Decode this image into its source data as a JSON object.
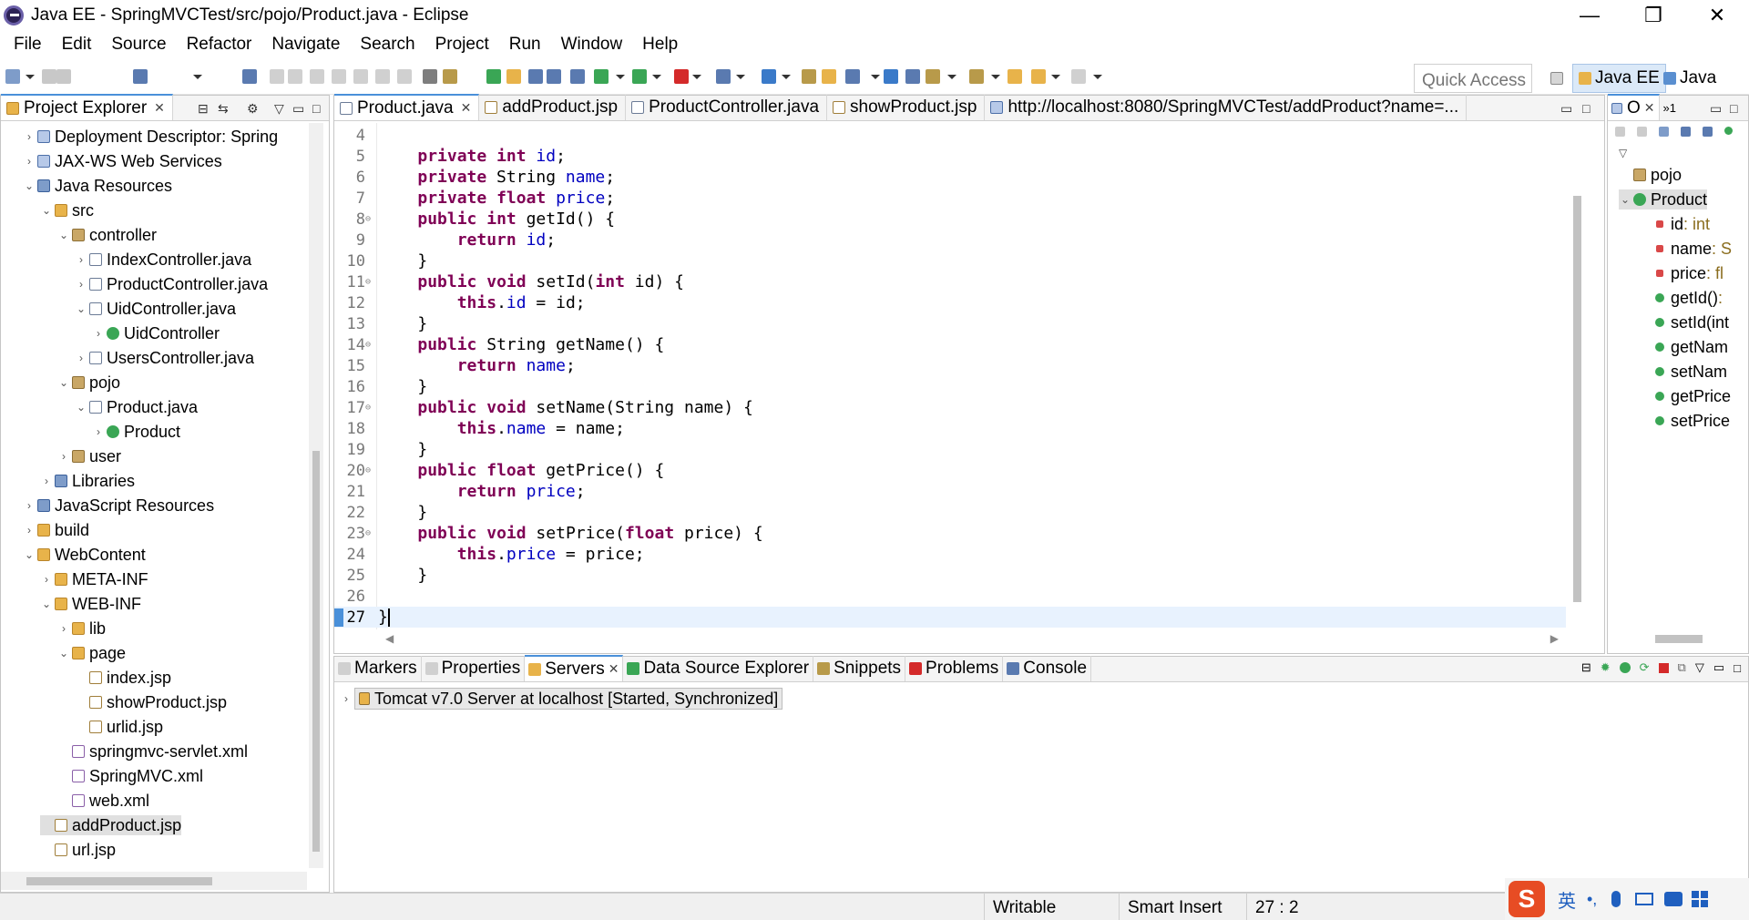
{
  "window": {
    "title": "Java EE - SpringMVCTest/src/pojo/Product.java - Eclipse",
    "minimize": "—",
    "restore": "❐",
    "close": "✕"
  },
  "menu": [
    "File",
    "Edit",
    "Source",
    "Refactor",
    "Navigate",
    "Search",
    "Project",
    "Run",
    "Window",
    "Help"
  ],
  "toolbar": {
    "quick_access": "Quick Access",
    "perspectives": [
      "Java EE",
      "Java"
    ]
  },
  "project_explorer": {
    "title": "Project Explorer",
    "close": "✕",
    "rows": [
      {
        "label": "Deployment Descriptor: Spring",
        "depth": 1,
        "tw": "›",
        "icon": "i-proj"
      },
      {
        "label": "JAX-WS Web Services",
        "depth": 1,
        "tw": "›",
        "icon": "i-proj"
      },
      {
        "label": "Java Resources",
        "depth": 1,
        "tw": "⌄",
        "icon": "i-lib"
      },
      {
        "label": "src",
        "depth": 2,
        "tw": "⌄",
        "icon": "i-folder"
      },
      {
        "label": "controller",
        "depth": 3,
        "tw": "⌄",
        "icon": "i-pkg"
      },
      {
        "label": "IndexController.java",
        "depth": 4,
        "tw": "›",
        "icon": "i-java"
      },
      {
        "label": "ProductController.java",
        "depth": 4,
        "tw": "›",
        "icon": "i-java"
      },
      {
        "label": "UidController.java",
        "depth": 4,
        "tw": "⌄",
        "icon": "i-java"
      },
      {
        "label": "UidController",
        "depth": 5,
        "tw": "›",
        "icon": "i-class"
      },
      {
        "label": "UsersController.java",
        "depth": 4,
        "tw": "›",
        "icon": "i-java"
      },
      {
        "label": "pojo",
        "depth": 3,
        "tw": "⌄",
        "icon": "i-pkg"
      },
      {
        "label": "Product.java",
        "depth": 4,
        "tw": "⌄",
        "icon": "i-java"
      },
      {
        "label": "Product",
        "depth": 5,
        "tw": "›",
        "icon": "i-class"
      },
      {
        "label": "user",
        "depth": 3,
        "tw": "›",
        "icon": "i-pkg"
      },
      {
        "label": "Libraries",
        "depth": 2,
        "tw": "›",
        "icon": "i-lib"
      },
      {
        "label": "JavaScript Resources",
        "depth": 1,
        "tw": "›",
        "icon": "i-lib"
      },
      {
        "label": "build",
        "depth": 1,
        "tw": "›",
        "icon": "i-folder"
      },
      {
        "label": "WebContent",
        "depth": 1,
        "tw": "⌄",
        "icon": "i-folder"
      },
      {
        "label": "META-INF",
        "depth": 2,
        "tw": "›",
        "icon": "i-folder"
      },
      {
        "label": "WEB-INF",
        "depth": 2,
        "tw": "⌄",
        "icon": "i-folder"
      },
      {
        "label": "lib",
        "depth": 3,
        "tw": "›",
        "icon": "i-folder"
      },
      {
        "label": "page",
        "depth": 3,
        "tw": "⌄",
        "icon": "i-folder"
      },
      {
        "label": "index.jsp",
        "depth": 4,
        "tw": "",
        "icon": "i-jsp"
      },
      {
        "label": "showProduct.jsp",
        "depth": 4,
        "tw": "",
        "icon": "i-jsp"
      },
      {
        "label": "urlid.jsp",
        "depth": 4,
        "tw": "",
        "icon": "i-jsp"
      },
      {
        "label": "springmvc-servlet.xml",
        "depth": 3,
        "tw": "",
        "icon": "i-xml"
      },
      {
        "label": "SpringMVC.xml",
        "depth": 3,
        "tw": "",
        "icon": "i-xml"
      },
      {
        "label": "web.xml",
        "depth": 3,
        "tw": "",
        "icon": "i-xml"
      },
      {
        "label": "addProduct.jsp",
        "depth": 2,
        "tw": "",
        "icon": "i-jsp",
        "selected": true
      },
      {
        "label": "url.jsp",
        "depth": 2,
        "tw": "",
        "icon": "i-jsp"
      }
    ]
  },
  "editor": {
    "tabs": [
      {
        "label": "Product.java",
        "close": "✕",
        "active": true
      },
      {
        "label": "addProduct.jsp",
        "active": false
      },
      {
        "label": "ProductController.java",
        "active": false
      },
      {
        "label": "showProduct.jsp",
        "active": false
      },
      {
        "label": "http://localhost:8080/SpringMVCTest/addProduct?name=...",
        "active": false
      }
    ],
    "lines": [
      {
        "n": "4",
        "fold": "",
        "seg": []
      },
      {
        "n": "5",
        "fold": "",
        "seg": [
          [
            "    ",
            ""
          ],
          [
            "private",
            "kw"
          ],
          [
            " ",
            ""
          ],
          [
            "int",
            "kw"
          ],
          [
            " ",
            ""
          ],
          [
            "id",
            "fd"
          ],
          [
            ";",
            ""
          ]
        ]
      },
      {
        "n": "6",
        "fold": "",
        "seg": [
          [
            "    ",
            ""
          ],
          [
            "private",
            "kw"
          ],
          [
            " String ",
            ""
          ],
          [
            "name",
            "fd"
          ],
          [
            ";",
            ""
          ]
        ]
      },
      {
        "n": "7",
        "fold": "",
        "seg": [
          [
            "    ",
            ""
          ],
          [
            "private",
            "kw"
          ],
          [
            " ",
            ""
          ],
          [
            "float",
            "kw"
          ],
          [
            " ",
            ""
          ],
          [
            "price",
            "fd"
          ],
          [
            ";",
            ""
          ]
        ]
      },
      {
        "n": "8",
        "fold": "⊖",
        "seg": [
          [
            "    ",
            ""
          ],
          [
            "public",
            "kw"
          ],
          [
            " ",
            ""
          ],
          [
            "int",
            "kw"
          ],
          [
            " getId() {",
            ""
          ]
        ]
      },
      {
        "n": "9",
        "fold": "",
        "seg": [
          [
            "        ",
            ""
          ],
          [
            "return",
            "kw"
          ],
          [
            " ",
            ""
          ],
          [
            "id",
            "fd"
          ],
          [
            ";",
            ""
          ]
        ]
      },
      {
        "n": "10",
        "fold": "",
        "seg": [
          [
            "    }",
            ""
          ]
        ]
      },
      {
        "n": "11",
        "fold": "⊖",
        "seg": [
          [
            "    ",
            ""
          ],
          [
            "public",
            "kw"
          ],
          [
            " ",
            ""
          ],
          [
            "void",
            "kw"
          ],
          [
            " setId(",
            ""
          ],
          [
            "int",
            "kw"
          ],
          [
            " id) {",
            ""
          ]
        ]
      },
      {
        "n": "12",
        "fold": "",
        "seg": [
          [
            "        ",
            ""
          ],
          [
            "this",
            "kw"
          ],
          [
            ".",
            ""
          ],
          [
            "id",
            "fd"
          ],
          [
            " = id;",
            ""
          ]
        ]
      },
      {
        "n": "13",
        "fold": "",
        "seg": [
          [
            "    }",
            ""
          ]
        ]
      },
      {
        "n": "14",
        "fold": "⊖",
        "seg": [
          [
            "    ",
            ""
          ],
          [
            "public",
            "kw"
          ],
          [
            " String getName() {",
            ""
          ]
        ]
      },
      {
        "n": "15",
        "fold": "",
        "seg": [
          [
            "        ",
            ""
          ],
          [
            "return",
            "kw"
          ],
          [
            " ",
            ""
          ],
          [
            "name",
            "fd"
          ],
          [
            ";",
            ""
          ]
        ]
      },
      {
        "n": "16",
        "fold": "",
        "seg": [
          [
            "    }",
            ""
          ]
        ]
      },
      {
        "n": "17",
        "fold": "⊖",
        "seg": [
          [
            "    ",
            ""
          ],
          [
            "public",
            "kw"
          ],
          [
            " ",
            ""
          ],
          [
            "void",
            "kw"
          ],
          [
            " setName(String name) {",
            ""
          ]
        ]
      },
      {
        "n": "18",
        "fold": "",
        "seg": [
          [
            "        ",
            ""
          ],
          [
            "this",
            "kw"
          ],
          [
            ".",
            ""
          ],
          [
            "name",
            "fd"
          ],
          [
            " = name;",
            ""
          ]
        ]
      },
      {
        "n": "19",
        "fold": "",
        "seg": [
          [
            "    }",
            ""
          ]
        ]
      },
      {
        "n": "20",
        "fold": "⊖",
        "seg": [
          [
            "    ",
            ""
          ],
          [
            "public",
            "kw"
          ],
          [
            " ",
            ""
          ],
          [
            "float",
            "kw"
          ],
          [
            " getPrice() {",
            ""
          ]
        ]
      },
      {
        "n": "21",
        "fold": "",
        "seg": [
          [
            "        ",
            ""
          ],
          [
            "return",
            "kw"
          ],
          [
            " ",
            ""
          ],
          [
            "price",
            "fd"
          ],
          [
            ";",
            ""
          ]
        ]
      },
      {
        "n": "22",
        "fold": "",
        "seg": [
          [
            "    }",
            ""
          ]
        ]
      },
      {
        "n": "23",
        "fold": "⊖",
        "seg": [
          [
            "    ",
            ""
          ],
          [
            "public",
            "kw"
          ],
          [
            " ",
            ""
          ],
          [
            "void",
            "kw"
          ],
          [
            " setPrice(",
            ""
          ],
          [
            "float",
            "kw"
          ],
          [
            " price) {",
            ""
          ]
        ]
      },
      {
        "n": "24",
        "fold": "",
        "seg": [
          [
            "        ",
            ""
          ],
          [
            "this",
            "kw"
          ],
          [
            ".",
            ""
          ],
          [
            "price",
            "fd"
          ],
          [
            " = price;",
            ""
          ]
        ]
      },
      {
        "n": "25",
        "fold": "",
        "seg": [
          [
            "    }",
            ""
          ]
        ]
      },
      {
        "n": "26",
        "fold": "",
        "seg": []
      },
      {
        "n": "27",
        "fold": "",
        "seg": [
          [
            "}",
            ""
          ]
        ],
        "current": true
      }
    ]
  },
  "outline": {
    "title": "O",
    "close": "✕",
    "badge": "»1",
    "rows": [
      {
        "label": "pojo",
        "type": "",
        "depth": 0,
        "tw": "",
        "icon": "i-pkg"
      },
      {
        "label": "Product",
        "type": "",
        "depth": 0,
        "tw": "⌄",
        "icon": "i-class",
        "selected": true
      },
      {
        "label": "id",
        "type": " : int",
        "depth": 1,
        "tw": "",
        "icon": "i-field"
      },
      {
        "label": "name",
        "type": " : S",
        "depth": 1,
        "tw": "",
        "icon": "i-field"
      },
      {
        "label": "price",
        "type": " : fl",
        "depth": 1,
        "tw": "",
        "icon": "i-field"
      },
      {
        "label": "getId()",
        "type": " :",
        "depth": 1,
        "tw": "",
        "icon": "i-method"
      },
      {
        "label": "setId(int",
        "type": "",
        "depth": 1,
        "tw": "",
        "icon": "i-method"
      },
      {
        "label": "getNam",
        "type": "",
        "depth": 1,
        "tw": "",
        "icon": "i-method"
      },
      {
        "label": "setNam",
        "type": "",
        "depth": 1,
        "tw": "",
        "icon": "i-method"
      },
      {
        "label": "getPrice",
        "type": "",
        "depth": 1,
        "tw": "",
        "icon": "i-method"
      },
      {
        "label": "setPrice",
        "type": "",
        "depth": 1,
        "tw": "",
        "icon": "i-method"
      }
    ]
  },
  "bottom_panel": {
    "tabs": [
      {
        "label": "Markers",
        "active": false
      },
      {
        "label": "Properties",
        "active": false
      },
      {
        "label": "Servers",
        "close": "✕",
        "active": true
      },
      {
        "label": "Data Source Explorer",
        "active": false
      },
      {
        "label": "Snippets",
        "active": false
      },
      {
        "label": "Problems",
        "active": false
      },
      {
        "label": "Console",
        "active": false
      }
    ],
    "server": "Tomcat v7.0 Server at localhost  [Started, Synchronized]"
  },
  "status_bar": {
    "writable": "Writable",
    "insert_mode": "Smart Insert",
    "position": "27 : 2"
  },
  "ime": {
    "label": "英",
    "punct": "•,"
  },
  "colors": {
    "keyword": "#7f0055",
    "field": "#0000c0",
    "line_number": "#787878",
    "current_line": "#e8f2fe",
    "tab_accent": "#4a90d9"
  }
}
